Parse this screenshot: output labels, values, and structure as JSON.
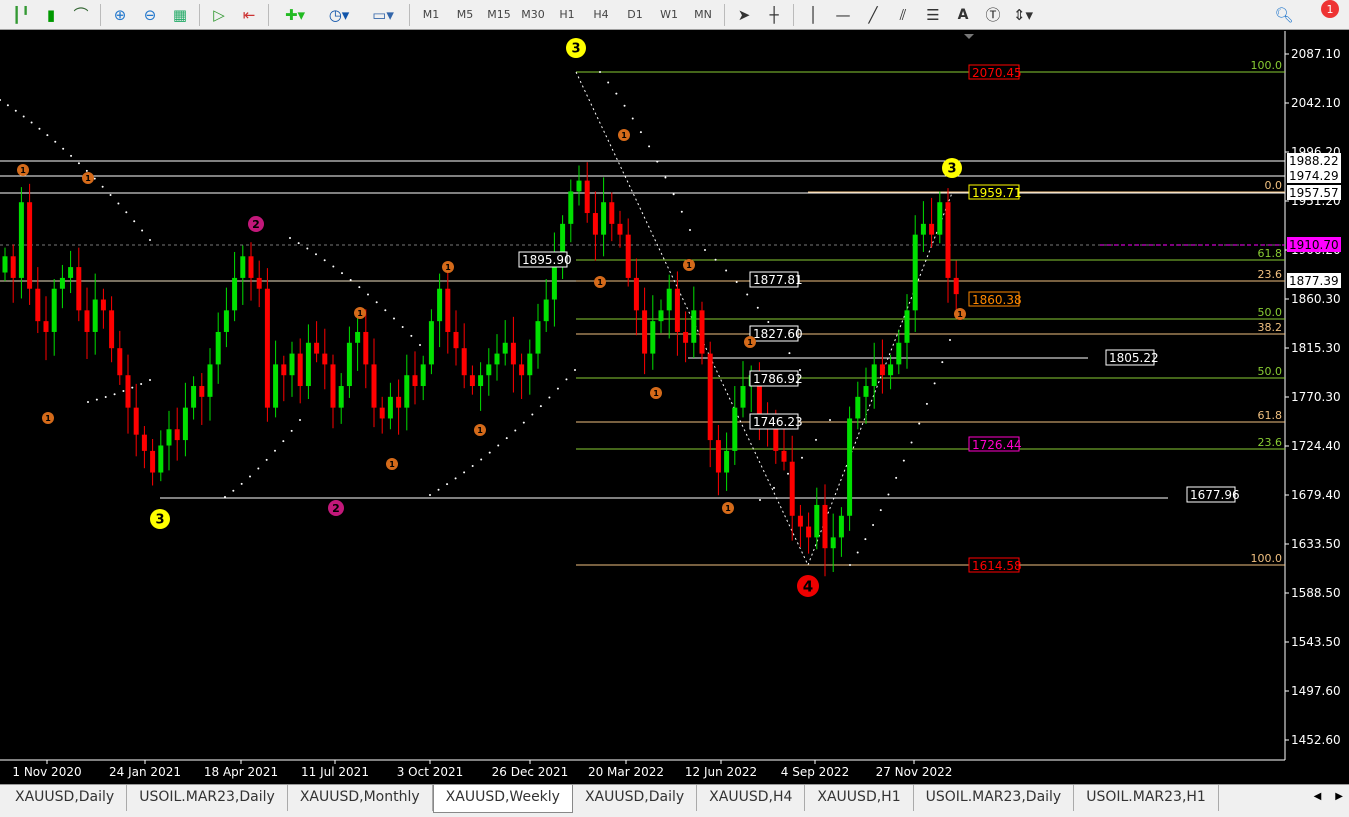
{
  "toolbar": {
    "timeframes": [
      "M1",
      "M5",
      "M15",
      "M30",
      "H1",
      "H4",
      "D1",
      "W1",
      "MN"
    ],
    "notification_count": "1",
    "text_tool": "A"
  },
  "axis": {
    "ticks": [
      "2087.10",
      "2042.10",
      "1996.20",
      "1951.20",
      "1906.20",
      "1860.30",
      "1815.30",
      "1770.30",
      "1724.40",
      "1679.40",
      "1633.50",
      "1588.50",
      "1543.50",
      "1497.60",
      "1452.60"
    ],
    "markers": [
      {
        "text": "1988.22",
        "style": "white"
      },
      {
        "text": "1974.29",
        "style": "white"
      },
      {
        "text": "1957.57",
        "style": "white"
      },
      {
        "text": "1910.70",
        "style": "magenta"
      },
      {
        "text": "1877.39",
        "style": "white"
      }
    ]
  },
  "dates": [
    "1 Nov 2020",
    "24 Jan 2021",
    "18 Apr 2021",
    "11 Jul 2021",
    "3 Oct 2021",
    "26 Dec 2021",
    "20 Mar 2022",
    "12 Jun 2022",
    "4 Sep 2022",
    "27 Nov 2022"
  ],
  "price_labels": [
    "1895.90",
    "1877.81",
    "1827.60",
    "1786.92",
    "1746.23",
    "1805.22",
    "1677.96"
  ],
  "fib_prices": [
    "2070.45",
    "1959.71",
    "1860.38",
    "1726.44",
    "1614.58"
  ],
  "fib_levels": [
    "100.0",
    "0.0",
    "61.8",
    "23.6",
    "50.0",
    "38.2",
    "50.0",
    "61.8",
    "23.6",
    "100.0"
  ],
  "wave_labels": {
    "three": "3",
    "two": "2",
    "four": "4",
    "one": "1"
  },
  "tabs": [
    "XAUUSD,Daily",
    "USOIL.MAR23,Daily",
    "XAUUSD,Monthly",
    "XAUUSD,Weekly",
    "XAUUSD,Daily",
    "XAUUSD,H4",
    "XAUUSD,H1",
    "USOIL.MAR23,Daily",
    "USOIL.MAR23,H1"
  ],
  "active_tab": "XAUUSD,Weekly",
  "chart_data": {
    "type": "candlestick",
    "symbol": "XAUUSD",
    "timeframe": "Weekly",
    "ylim": [
      1452.6,
      2087.1
    ],
    "closes": [
      1900,
      1880,
      1950,
      1870,
      1840,
      1830,
      1870,
      1880,
      1890,
      1850,
      1830,
      1860,
      1850,
      1815,
      1790,
      1760,
      1735,
      1720,
      1700,
      1725,
      1740,
      1730,
      1760,
      1780,
      1770,
      1800,
      1830,
      1850,
      1880,
      1900,
      1880,
      1870,
      1760,
      1800,
      1790,
      1810,
      1780,
      1820,
      1810,
      1800,
      1760,
      1780,
      1820,
      1830,
      1800,
      1760,
      1750,
      1770,
      1760,
      1790,
      1780,
      1800,
      1840,
      1870,
      1830,
      1815,
      1790,
      1780,
      1790,
      1800,
      1810,
      1820,
      1800,
      1790,
      1810,
      1840,
      1860,
      1900,
      1930,
      1960,
      1970,
      1940,
      1920,
      1950,
      1930,
      1920,
      1880,
      1850,
      1810,
      1840,
      1850,
      1870,
      1830,
      1820,
      1850,
      1810,
      1730,
      1700,
      1720,
      1760,
      1780,
      1790,
      1750,
      1740,
      1720,
      1710,
      1660,
      1650,
      1640,
      1670,
      1630,
      1640,
      1660,
      1750,
      1770,
      1780,
      1800,
      1790,
      1800,
      1820,
      1850,
      1920,
      1930,
      1920,
      1950,
      1880,
      1865
    ],
    "bull_color": "#00e000",
    "bear_color": "#ff0000"
  }
}
